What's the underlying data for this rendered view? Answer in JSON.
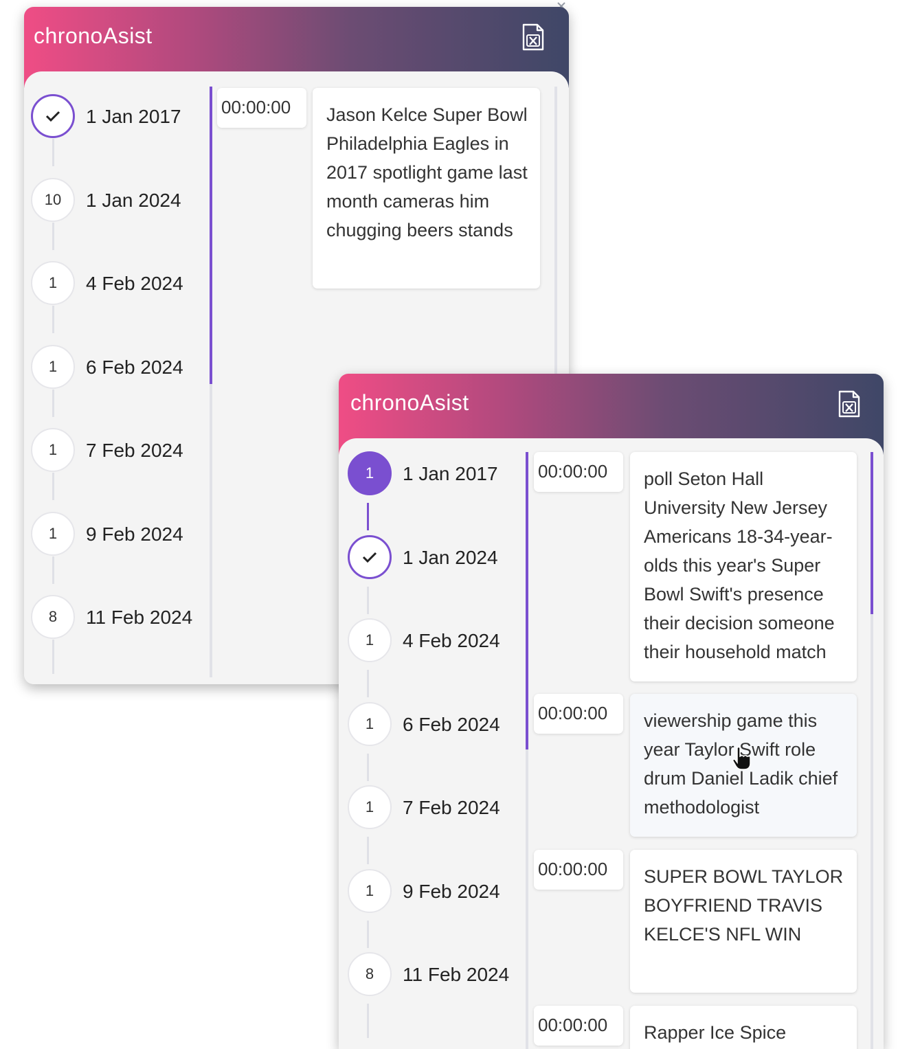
{
  "app": {
    "title": "chronoAsist",
    "accent_color": "#7a4fd0",
    "header_gradient": [
      "#ef4d85",
      "#3f4767"
    ],
    "export_icon": "excel-export-icon"
  },
  "back_panel": {
    "dates": [
      {
        "badge": "",
        "checked": true,
        "label": "1 Jan 2017"
      },
      {
        "badge": "10",
        "label": "1 Jan 2024"
      },
      {
        "badge": "1",
        "label": "4 Feb 2024"
      },
      {
        "badge": "1",
        "label": "6 Feb 2024"
      },
      {
        "badge": "1",
        "label": "7 Feb 2024"
      },
      {
        "badge": "1",
        "label": "9 Feb 2024"
      },
      {
        "badge": "8",
        "label": "11 Feb 2024"
      }
    ],
    "entries": [
      {
        "time": "00:00:00",
        "text": "Jason Kelce Super Bowl Philadelphia Eagles in 2017 spotlight game last month cameras him chugging beers stands"
      }
    ]
  },
  "front_panel": {
    "dates": [
      {
        "badge": "1",
        "selected": true,
        "label": "1 Jan 2017"
      },
      {
        "badge": "",
        "checked": true,
        "label": "1 Jan 2024"
      },
      {
        "badge": "1",
        "label": "4 Feb 2024"
      },
      {
        "badge": "1",
        "label": "6 Feb 2024"
      },
      {
        "badge": "1",
        "label": "7 Feb 2024"
      },
      {
        "badge": "1",
        "label": "9 Feb 2024"
      },
      {
        "badge": "8",
        "label": "11 Feb 2024"
      }
    ],
    "entries": [
      {
        "time": "00:00:00",
        "text": "poll Seton Hall University New Jersey Americans 18-34-year-olds this year's Super Bowl Swift's presence their decision someone their household match"
      },
      {
        "time": "00:00:00",
        "text": "viewership game this year Taylor Swift role drum Daniel Ladik chief methodologist"
      },
      {
        "time": "00:00:00",
        "text": "SUPER BOWL TAYLOR BOYFRIEND TRAVIS KELCE'S NFL WIN"
      },
      {
        "time": "00:00:00",
        "text": "Rapper Ice Spice"
      }
    ]
  }
}
